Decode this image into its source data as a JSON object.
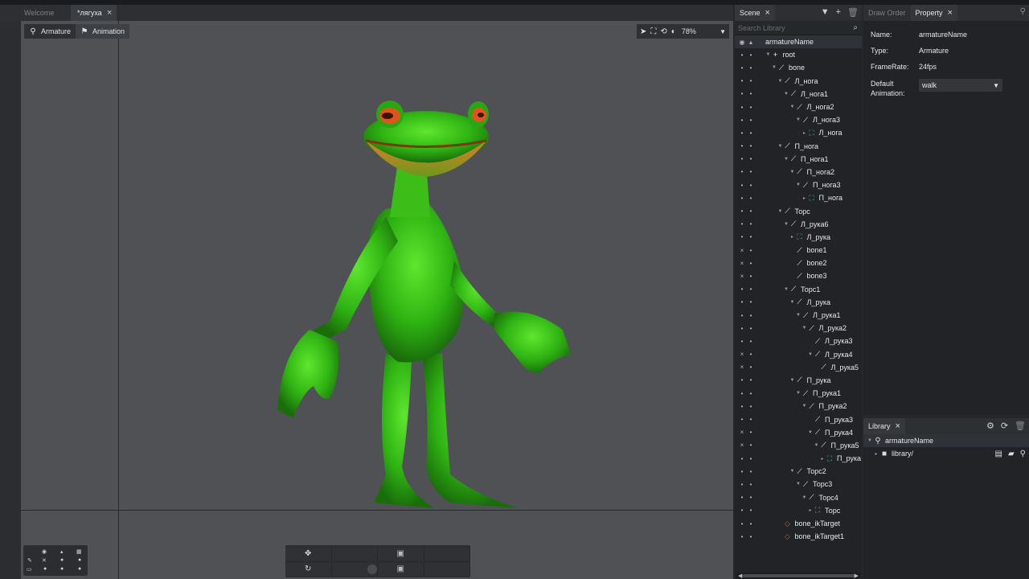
{
  "tabs": [
    {
      "label": "Welcome",
      "active": false
    },
    {
      "label": "*лягуха",
      "active": true
    }
  ],
  "viewport": {
    "modes": [
      {
        "label": "Armature",
        "icon": "figure-icon",
        "active": false
      },
      {
        "label": "Animation",
        "icon": "running-icon",
        "active": true
      }
    ],
    "zoom": "78%"
  },
  "scene_panel": {
    "tabs": [
      {
        "label": "Scene"
      }
    ],
    "search_placeholder": "Search Library",
    "tree": [
      {
        "label": "armatureName",
        "depth": 0,
        "icon": "none",
        "vis": "eye",
        "expanded": false,
        "selected": true
      },
      {
        "label": "root",
        "depth": 1,
        "icon": "cross",
        "vis": "dot",
        "expanded": true
      },
      {
        "label": "bone",
        "depth": 2,
        "icon": "bone",
        "vis": "dot",
        "expanded": true
      },
      {
        "label": "Л_нога",
        "depth": 3,
        "icon": "bone",
        "vis": "dot",
        "expanded": true
      },
      {
        "label": "Л_нога1",
        "depth": 4,
        "icon": "bone",
        "vis": "dot",
        "expanded": true
      },
      {
        "label": "Л_нога2",
        "depth": 5,
        "icon": "bone",
        "vis": "dot",
        "expanded": true
      },
      {
        "label": "Л_нога3",
        "depth": 6,
        "icon": "bone",
        "vis": "dot",
        "expanded": true
      },
      {
        "label": "Л_нога",
        "depth": 7,
        "icon": "mesh",
        "vis": "dot",
        "expanded": false
      },
      {
        "label": "П_нога",
        "depth": 3,
        "icon": "bone",
        "vis": "dot",
        "expanded": true
      },
      {
        "label": "П_нога1",
        "depth": 4,
        "icon": "bone",
        "vis": "dot",
        "expanded": true
      },
      {
        "label": "П_нога2",
        "depth": 5,
        "icon": "bone",
        "vis": "dot",
        "expanded": true
      },
      {
        "label": "П_нога3",
        "depth": 6,
        "icon": "bone",
        "vis": "dot",
        "expanded": true
      },
      {
        "label": "П_нога",
        "depth": 7,
        "icon": "mesh",
        "vis": "dot",
        "expanded": false
      },
      {
        "label": "Торс",
        "depth": 3,
        "icon": "bone",
        "vis": "dot",
        "expanded": true
      },
      {
        "label": "Л_рука6",
        "depth": 4,
        "icon": "bone",
        "vis": "dot",
        "expanded": true
      },
      {
        "label": "Л_рука",
        "depth": 5,
        "icon": "mesh",
        "vis": "dot",
        "expanded": false
      },
      {
        "label": "bone1",
        "depth": 5,
        "icon": "bone",
        "vis": "x",
        "expanded": null
      },
      {
        "label": "bone2",
        "depth": 5,
        "icon": "bone",
        "vis": "x",
        "expanded": null
      },
      {
        "label": "bone3",
        "depth": 5,
        "icon": "bone",
        "vis": "x",
        "expanded": null
      },
      {
        "label": "Торс1",
        "depth": 4,
        "icon": "bone",
        "vis": "dot",
        "expanded": true
      },
      {
        "label": "Л_рука",
        "depth": 5,
        "icon": "bone",
        "vis": "dot",
        "expanded": true
      },
      {
        "label": "Л_рука1",
        "depth": 6,
        "icon": "bone",
        "vis": "dot",
        "expanded": true
      },
      {
        "label": "Л_рука2",
        "depth": 7,
        "icon": "bone",
        "vis": "dot",
        "expanded": true
      },
      {
        "label": "Л_рука3",
        "depth": 8,
        "icon": "bone",
        "vis": "dot",
        "expanded": null
      },
      {
        "label": "Л_рука4",
        "depth": 8,
        "icon": "bone",
        "vis": "x",
        "expanded": true
      },
      {
        "label": "Л_рука5",
        "depth": 9,
        "icon": "bone",
        "vis": "x",
        "expanded": null
      },
      {
        "label": "П_рука",
        "depth": 5,
        "icon": "bone",
        "vis": "dot",
        "expanded": true
      },
      {
        "label": "П_рука1",
        "depth": 6,
        "icon": "bone",
        "vis": "dot",
        "expanded": true
      },
      {
        "label": "П_рука2",
        "depth": 7,
        "icon": "bone",
        "vis": "dot",
        "expanded": true
      },
      {
        "label": "П_рука3",
        "depth": 8,
        "icon": "bone",
        "vis": "dot",
        "expanded": null
      },
      {
        "label": "П_рука4",
        "depth": 8,
        "icon": "bone",
        "vis": "x",
        "expanded": true
      },
      {
        "label": "П_рука5",
        "depth": 9,
        "icon": "bone",
        "vis": "x",
        "expanded": true
      },
      {
        "label": "П_рука",
        "depth": 10,
        "icon": "mesh",
        "vis": "dot",
        "expanded": false
      },
      {
        "label": "Торс2",
        "depth": 5,
        "icon": "bone",
        "vis": "dot",
        "expanded": true
      },
      {
        "label": "Торс3",
        "depth": 6,
        "icon": "bone",
        "vis": "dot",
        "expanded": true
      },
      {
        "label": "Торс4",
        "depth": 7,
        "icon": "bone",
        "vis": "dot",
        "expanded": true
      },
      {
        "label": "Торс",
        "depth": 8,
        "icon": "mesh",
        "vis": "dot",
        "expanded": false
      },
      {
        "label": "bone_ikTarget",
        "depth": 3,
        "icon": "ik",
        "vis": "dot",
        "expanded": null
      },
      {
        "label": "bone_ikTarget1",
        "depth": 3,
        "icon": "ik",
        "vis": "dot",
        "expanded": null
      }
    ]
  },
  "property_panel": {
    "tabs": [
      {
        "label": "Draw Order",
        "active": false
      },
      {
        "label": "Property",
        "active": true
      }
    ],
    "name_label": "Name:",
    "name_value": "armatureName",
    "type_label": "Type:",
    "type_value": "Armature",
    "framerate_label": "FrameRate:",
    "framerate_value": "24fps",
    "default_anim_label": "Default Animation:",
    "default_anim_value": "walk"
  },
  "library_panel": {
    "tab": "Library",
    "items": [
      {
        "label": "armatureName",
        "selected": true
      },
      {
        "label": "library/",
        "selected": false
      }
    ]
  },
  "colors": {
    "accent_ik": "#e0552d",
    "accent_mesh": "#45c3b5",
    "viewport_bg": "#505155"
  }
}
